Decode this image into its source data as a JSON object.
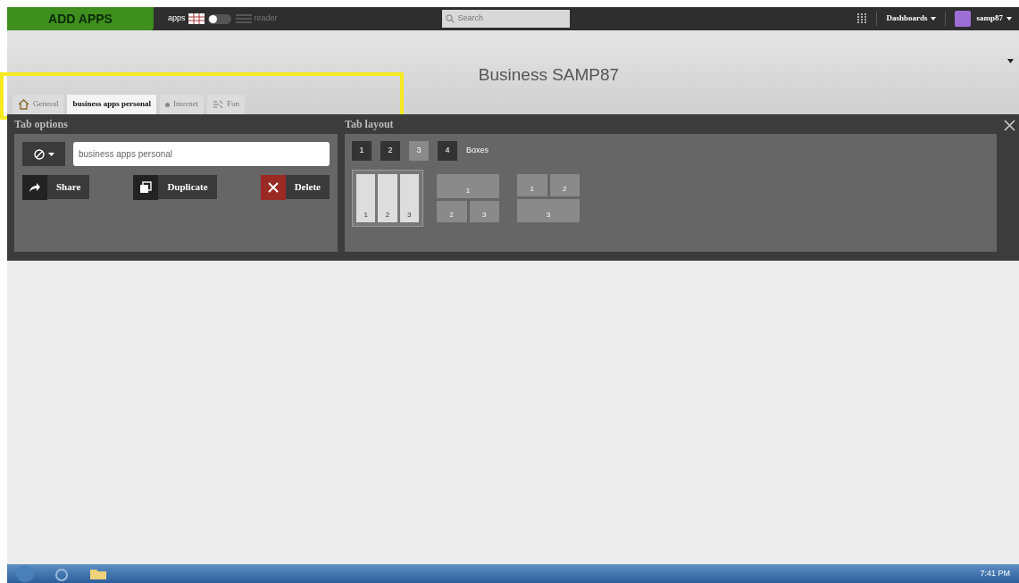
{
  "top_bar": {
    "add_apps": "ADD APPS",
    "view_toggle": {
      "left_label": "apps",
      "right_label": "reader",
      "on": false
    },
    "search": {
      "placeholder": "Search"
    },
    "dashboards": "Dashboards",
    "user": "samp87"
  },
  "dashboard_title": "Business SAMP87",
  "tabs": [
    {
      "label": "General",
      "selected": false,
      "kind": "home"
    },
    {
      "label": "business apps personal",
      "selected": true,
      "kind": "plain"
    },
    {
      "label": "Internet",
      "selected": false,
      "kind": "bulleted"
    },
    {
      "label": "Fun",
      "selected": false,
      "kind": "feed"
    }
  ],
  "tab_options": {
    "title": "Tab options",
    "name_field": {
      "value": "business apps personal"
    },
    "buttons": [
      {
        "label": "Share",
        "kind": "share"
      },
      {
        "label": "Duplicate",
        "kind": "duplicate"
      },
      {
        "label": "Delete",
        "kind": "delete"
      }
    ]
  },
  "tab_layout": {
    "title": "Tab layout",
    "box_counts": [
      {
        "label": "1",
        "selected": false
      },
      {
        "label": "2",
        "selected": false
      },
      {
        "label": "3",
        "selected": true
      },
      {
        "label": "4",
        "selected": false
      }
    ],
    "boxes_label": "Boxes",
    "layouts": [
      {
        "kind": "three-columns",
        "selected": true,
        "cells": [
          "1",
          "2",
          "3"
        ]
      },
      {
        "kind": "one-over-two",
        "selected": false,
        "cells": [
          "1",
          "2",
          "3"
        ]
      },
      {
        "kind": "two-over-one",
        "selected": false,
        "cells": [
          "1",
          "2",
          "3"
        ]
      }
    ]
  },
  "taskbar": {
    "clock": "7:41 PM"
  }
}
